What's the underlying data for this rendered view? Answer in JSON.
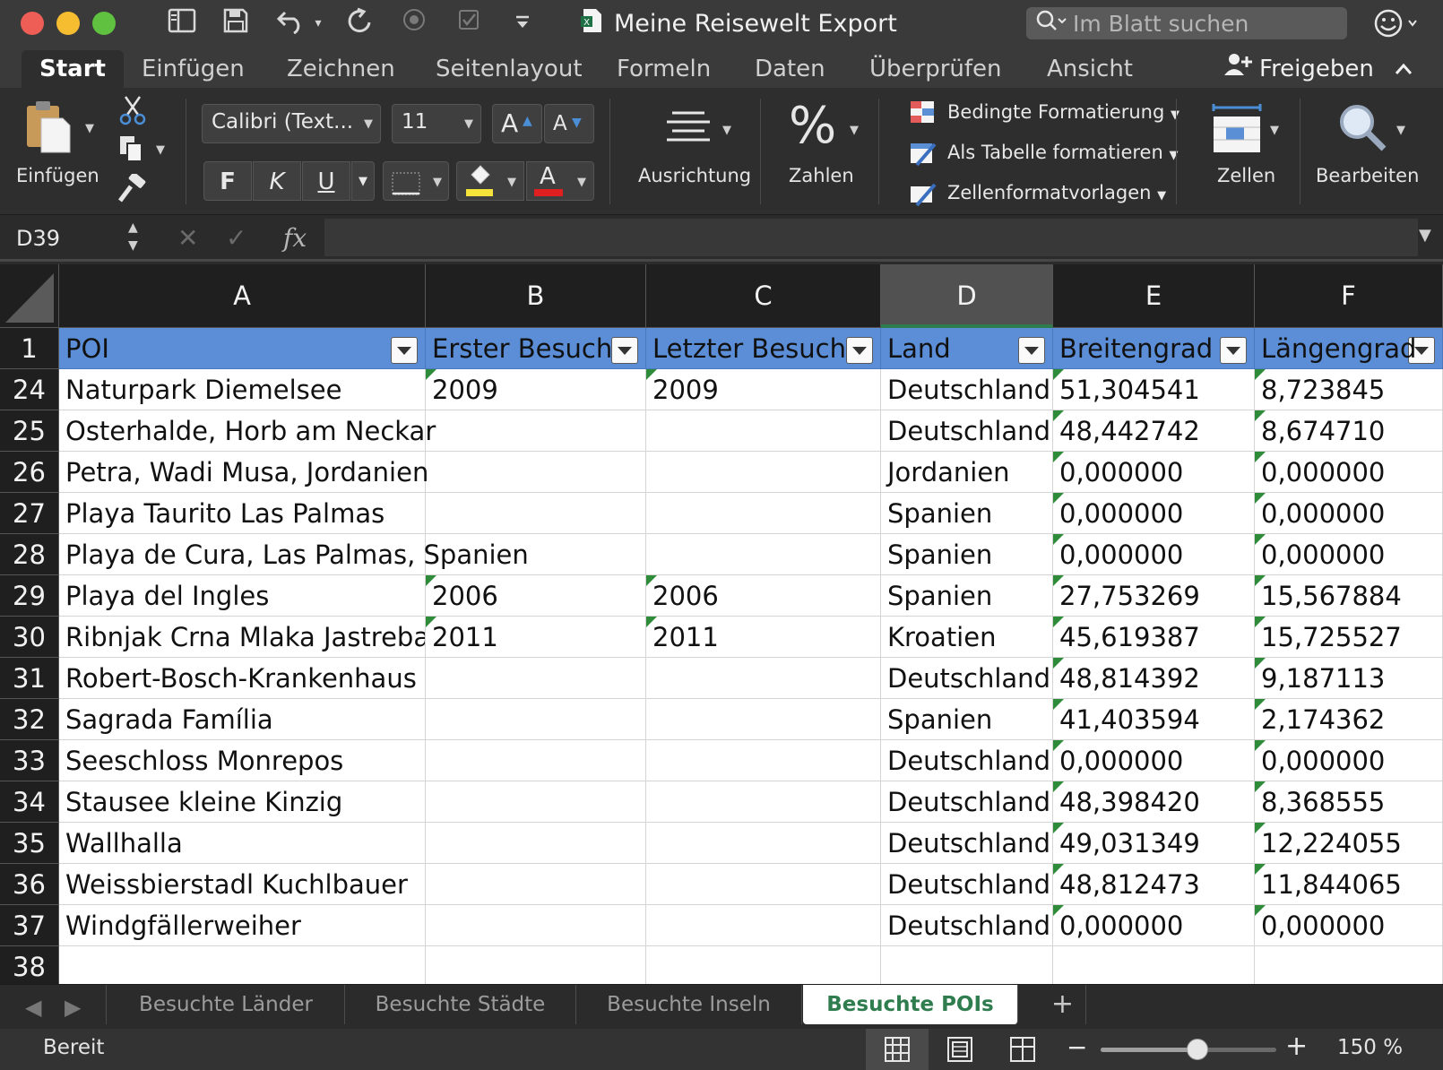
{
  "window": {
    "title": "Meine Reisewelt Export",
    "colors": {
      "close": "#ee5e57",
      "minimize": "#f5bd2f",
      "maximize": "#5fc13f",
      "accent": "#2f7d4f",
      "table_header": "#5b8ed6"
    },
    "toolbar_icons": [
      "sidebar-icon",
      "save-icon",
      "undo-icon",
      "redo-icon",
      "record-icon",
      "spellcheck-icon",
      "customize-icon"
    ]
  },
  "search": {
    "placeholder": "Im Blatt suchen"
  },
  "ribbon_tabs": [
    "Start",
    "Einfügen",
    "Zeichnen",
    "Seitenlayout",
    "Formeln",
    "Daten",
    "Überprüfen",
    "Ansicht"
  ],
  "active_tab": "Start",
  "share_label": "Freigeben",
  "ribbon": {
    "paste_label": "Einfügen",
    "font_name": "Calibri (Text...",
    "font_size": "11",
    "grow_font": "A",
    "shrink_font": "A",
    "bold": "F",
    "italic": "K",
    "underline": "U",
    "font_color_glyph": "A",
    "highlight_color": "#f5e23a",
    "font_color": "#e02020",
    "alignment_label": "Ausrichtung",
    "number_glyph": "%",
    "number_label": "Zahlen",
    "conditional_format": "Bedingte Formatierung",
    "format_as_table": "Als Tabelle formatieren",
    "cell_styles": "Zellenformatvorlagen",
    "cells_label": "Zellen",
    "edit_label": "Bearbeiten"
  },
  "formula_bar": {
    "name_box": "D39",
    "fx": "fx",
    "formula": ""
  },
  "grid": {
    "columns": [
      "A",
      "B",
      "C",
      "D",
      "E",
      "F"
    ],
    "selected_column": "D",
    "header_row_number": "1",
    "headers": [
      "POI",
      "Erster Besuch",
      "Letzter Besuch",
      "Land",
      "Breitengrad",
      "Längengrad"
    ],
    "rows": [
      {
        "n": "24",
        "cells": [
          "Naturpark Diemelsee",
          "2009",
          "2009",
          "Deutschland",
          "51,304541",
          "8,723845"
        ]
      },
      {
        "n": "25",
        "cells": [
          "Osterhalde, Horb am Neckar",
          "",
          "",
          "Deutschland",
          "48,442742",
          "8,674710"
        ]
      },
      {
        "n": "26",
        "cells": [
          "Petra, Wadi Musa, Jordanien",
          "",
          "",
          "Jordanien",
          "0,000000",
          "0,000000"
        ]
      },
      {
        "n": "27",
        "cells": [
          "Playa Taurito Las Palmas",
          "",
          "",
          "Spanien",
          "0,000000",
          "0,000000"
        ]
      },
      {
        "n": "28",
        "cells": [
          "Playa de Cura, Las Palmas, Spanien",
          "",
          "",
          "Spanien",
          "0,000000",
          "0,000000"
        ]
      },
      {
        "n": "29",
        "cells": [
          "Playa del Ingles",
          "2006",
          "2006",
          "Spanien",
          "27,753269",
          "15,567884"
        ]
      },
      {
        "n": "30",
        "cells": [
          "Ribnjak Crna Mlaka Jastrebar",
          "2011",
          "2011",
          "Kroatien",
          "45,619387",
          "15,725527"
        ]
      },
      {
        "n": "31",
        "cells": [
          "Robert-Bosch-Krankenhaus",
          "",
          "",
          "Deutschland",
          "48,814392",
          "9,187113"
        ]
      },
      {
        "n": "32",
        "cells": [
          "Sagrada Família",
          "",
          "",
          "Spanien",
          "41,403594",
          "2,174362"
        ]
      },
      {
        "n": "33",
        "cells": [
          "Seeschloss Monrepos",
          "",
          "",
          "Deutschland",
          "0,000000",
          "0,000000"
        ]
      },
      {
        "n": "34",
        "cells": [
          "Stausee kleine Kinzig",
          "",
          "",
          "Deutschland",
          "48,398420",
          "8,368555"
        ]
      },
      {
        "n": "35",
        "cells": [
          "Wallhalla",
          "",
          "",
          "Deutschland",
          "49,031349",
          "12,224055"
        ]
      },
      {
        "n": "36",
        "cells": [
          "Weissbierstadl Kuchlbauer",
          "",
          "",
          "Deutschland",
          "48,812473",
          "11,844065"
        ]
      },
      {
        "n": "37",
        "cells": [
          "Windgfällerweiher",
          "",
          "",
          "Deutschland",
          "0,000000",
          "0,000000"
        ]
      },
      {
        "n": "38",
        "cells": [
          "",
          "",
          "",
          "",
          "",
          ""
        ]
      }
    ]
  },
  "sheets": [
    "Besuchte Länder",
    "Besuchte Städte",
    "Besuchte Inseln",
    "Besuchte POIs"
  ],
  "active_sheet": "Besuchte POIs",
  "add_sheet": "+",
  "status": {
    "text": "Bereit",
    "zoom": "150 %",
    "zoom_level_fraction": 0.55,
    "views": [
      "normal-view-icon",
      "page-layout-icon",
      "page-break-icon"
    ],
    "active_view": "normal-view-icon"
  }
}
